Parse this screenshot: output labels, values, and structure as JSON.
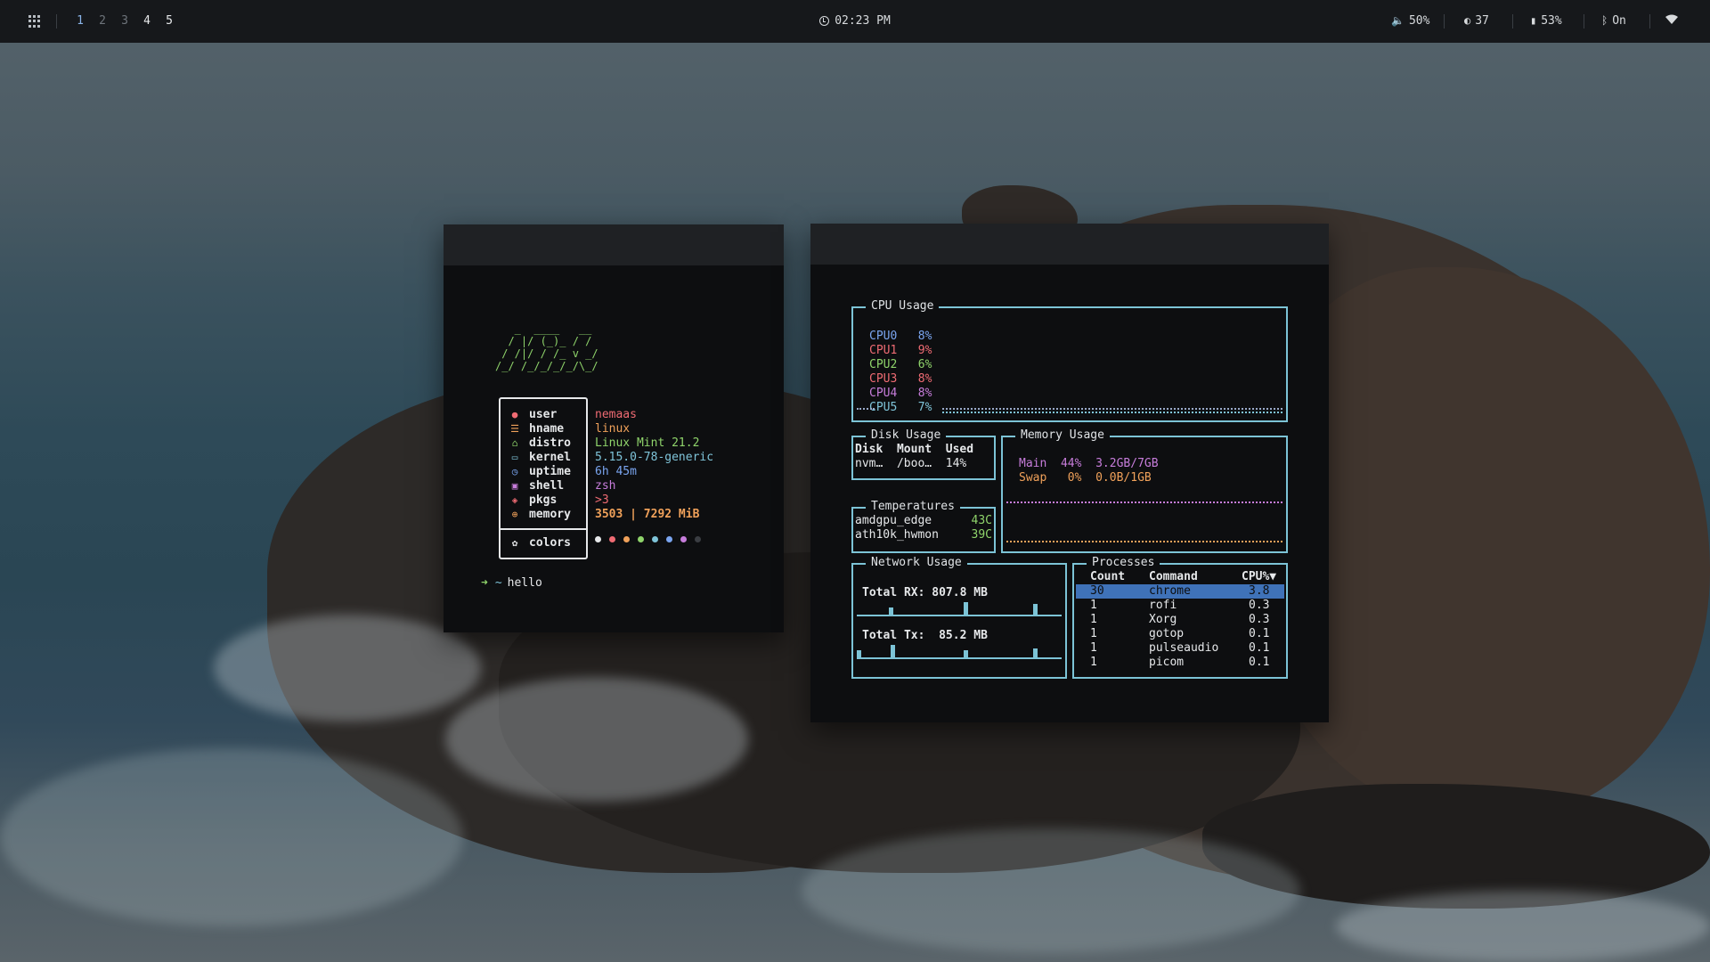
{
  "topbar": {
    "workspaces": [
      "1",
      "2",
      "3",
      "4",
      "5"
    ],
    "active_workspace": "1",
    "clock": "02:23 PM",
    "volume": "50%",
    "brightness": "37",
    "battery": "53%",
    "bluetooth": "On",
    "icons": [
      "apps-grid-icon",
      "clock-icon",
      "volume-icon",
      "brightness-icon",
      "battery-icon",
      "bluetooth-icon",
      "wifi-icon"
    ]
  },
  "neofetch": {
    "ascii_art": "   _  ____   __\n  / |/ (_)_ / /\n / /|/ / /_ v _/\n/_/ /_/_/_/_/\\_/",
    "rows": [
      {
        "icon": "user-icon",
        "label": "user",
        "value": "nemaas",
        "color": "#ef6b73"
      },
      {
        "icon": "hostname-icon",
        "label": "hname",
        "value": "linux",
        "color": "#f0a15a"
      },
      {
        "icon": "distro-icon",
        "label": "distro",
        "value": "Linux Mint 21.2",
        "color": "#8fd46b"
      },
      {
        "icon": "kernel-icon",
        "label": "kernel",
        "value": "5.15.0-78-generic",
        "color": "#7fc4d9"
      },
      {
        "icon": "uptime-icon",
        "label": "uptime",
        "value": "6h 45m",
        "color": "#7aa5f0"
      },
      {
        "icon": "shell-icon",
        "label": "shell",
        "value": "zsh",
        "color": "#c77ddb"
      },
      {
        "icon": "package-icon",
        "label": "pkgs",
        "value": ">3",
        "color": "#ef6b73"
      },
      {
        "icon": "memory-icon",
        "label": "memory",
        "value": "3503 | 7292 MiB",
        "color": "#f0a15a"
      }
    ],
    "colors_label": "colors",
    "palette": [
      "#e6e8ea",
      "#ef6b73",
      "#f0a15a",
      "#8fd46b",
      "#7fc4d9",
      "#7aa5f0",
      "#c77ddb",
      "#3a3d42"
    ],
    "prompt_symbol": "➜",
    "prompt_dir": "~",
    "prompt_command": "hello"
  },
  "gotop": {
    "cpu": {
      "title": "CPU Usage",
      "rows": [
        {
          "name": "CPU0",
          "value": "8%",
          "color": "#7aa5f0"
        },
        {
          "name": "CPU1",
          "value": "9%",
          "color": "#ef6b73"
        },
        {
          "name": "CPU2",
          "value": "6%",
          "color": "#8fd46b"
        },
        {
          "name": "CPU3",
          "value": "8%",
          "color": "#ef6b73"
        },
        {
          "name": "CPU4",
          "value": "8%",
          "color": "#c77ddb"
        },
        {
          "name": "CPU5",
          "value": "7%",
          "color": "#7fc4d9"
        }
      ]
    },
    "disk": {
      "title": "Disk Usage",
      "headers": [
        "Disk",
        "Mount",
        "Used"
      ],
      "rows": [
        [
          "nvm…",
          "/boo…",
          "14%"
        ]
      ]
    },
    "memory": {
      "title": "Memory Usage",
      "main_label": "Main",
      "main_pct": "44%",
      "main_amount": "3.2GB/7GB",
      "main_color": "#c77ddb",
      "swap_label": "Swap",
      "swap_pct": "0%",
      "swap_amount": "0.0B/1GB",
      "swap_color": "#f0a15a"
    },
    "temps": {
      "title": "Temperatures",
      "rows": [
        {
          "name": "amdgpu_edge",
          "value": "43C"
        },
        {
          "name": "ath10k_hwmon",
          "value": "39C"
        }
      ]
    },
    "network": {
      "title": "Network Usage",
      "rx_label": "Total RX:",
      "rx_value": "807.8 MB",
      "tx_label": "Total Tx:",
      "tx_value": "85.2 MB"
    },
    "processes": {
      "title": "Processes",
      "headers": [
        "Count",
        "Command",
        "CPU%▼"
      ],
      "rows": [
        [
          "30",
          "chrome",
          "3.8"
        ],
        [
          "1",
          "rofi",
          "0.3"
        ],
        [
          "1",
          "Xorg",
          "0.3"
        ],
        [
          "1",
          "gotop",
          "0.1"
        ],
        [
          "1",
          "pulseaudio",
          "0.1"
        ],
        [
          "1",
          "picom",
          "0.1"
        ]
      ],
      "selected_index": 0
    }
  }
}
